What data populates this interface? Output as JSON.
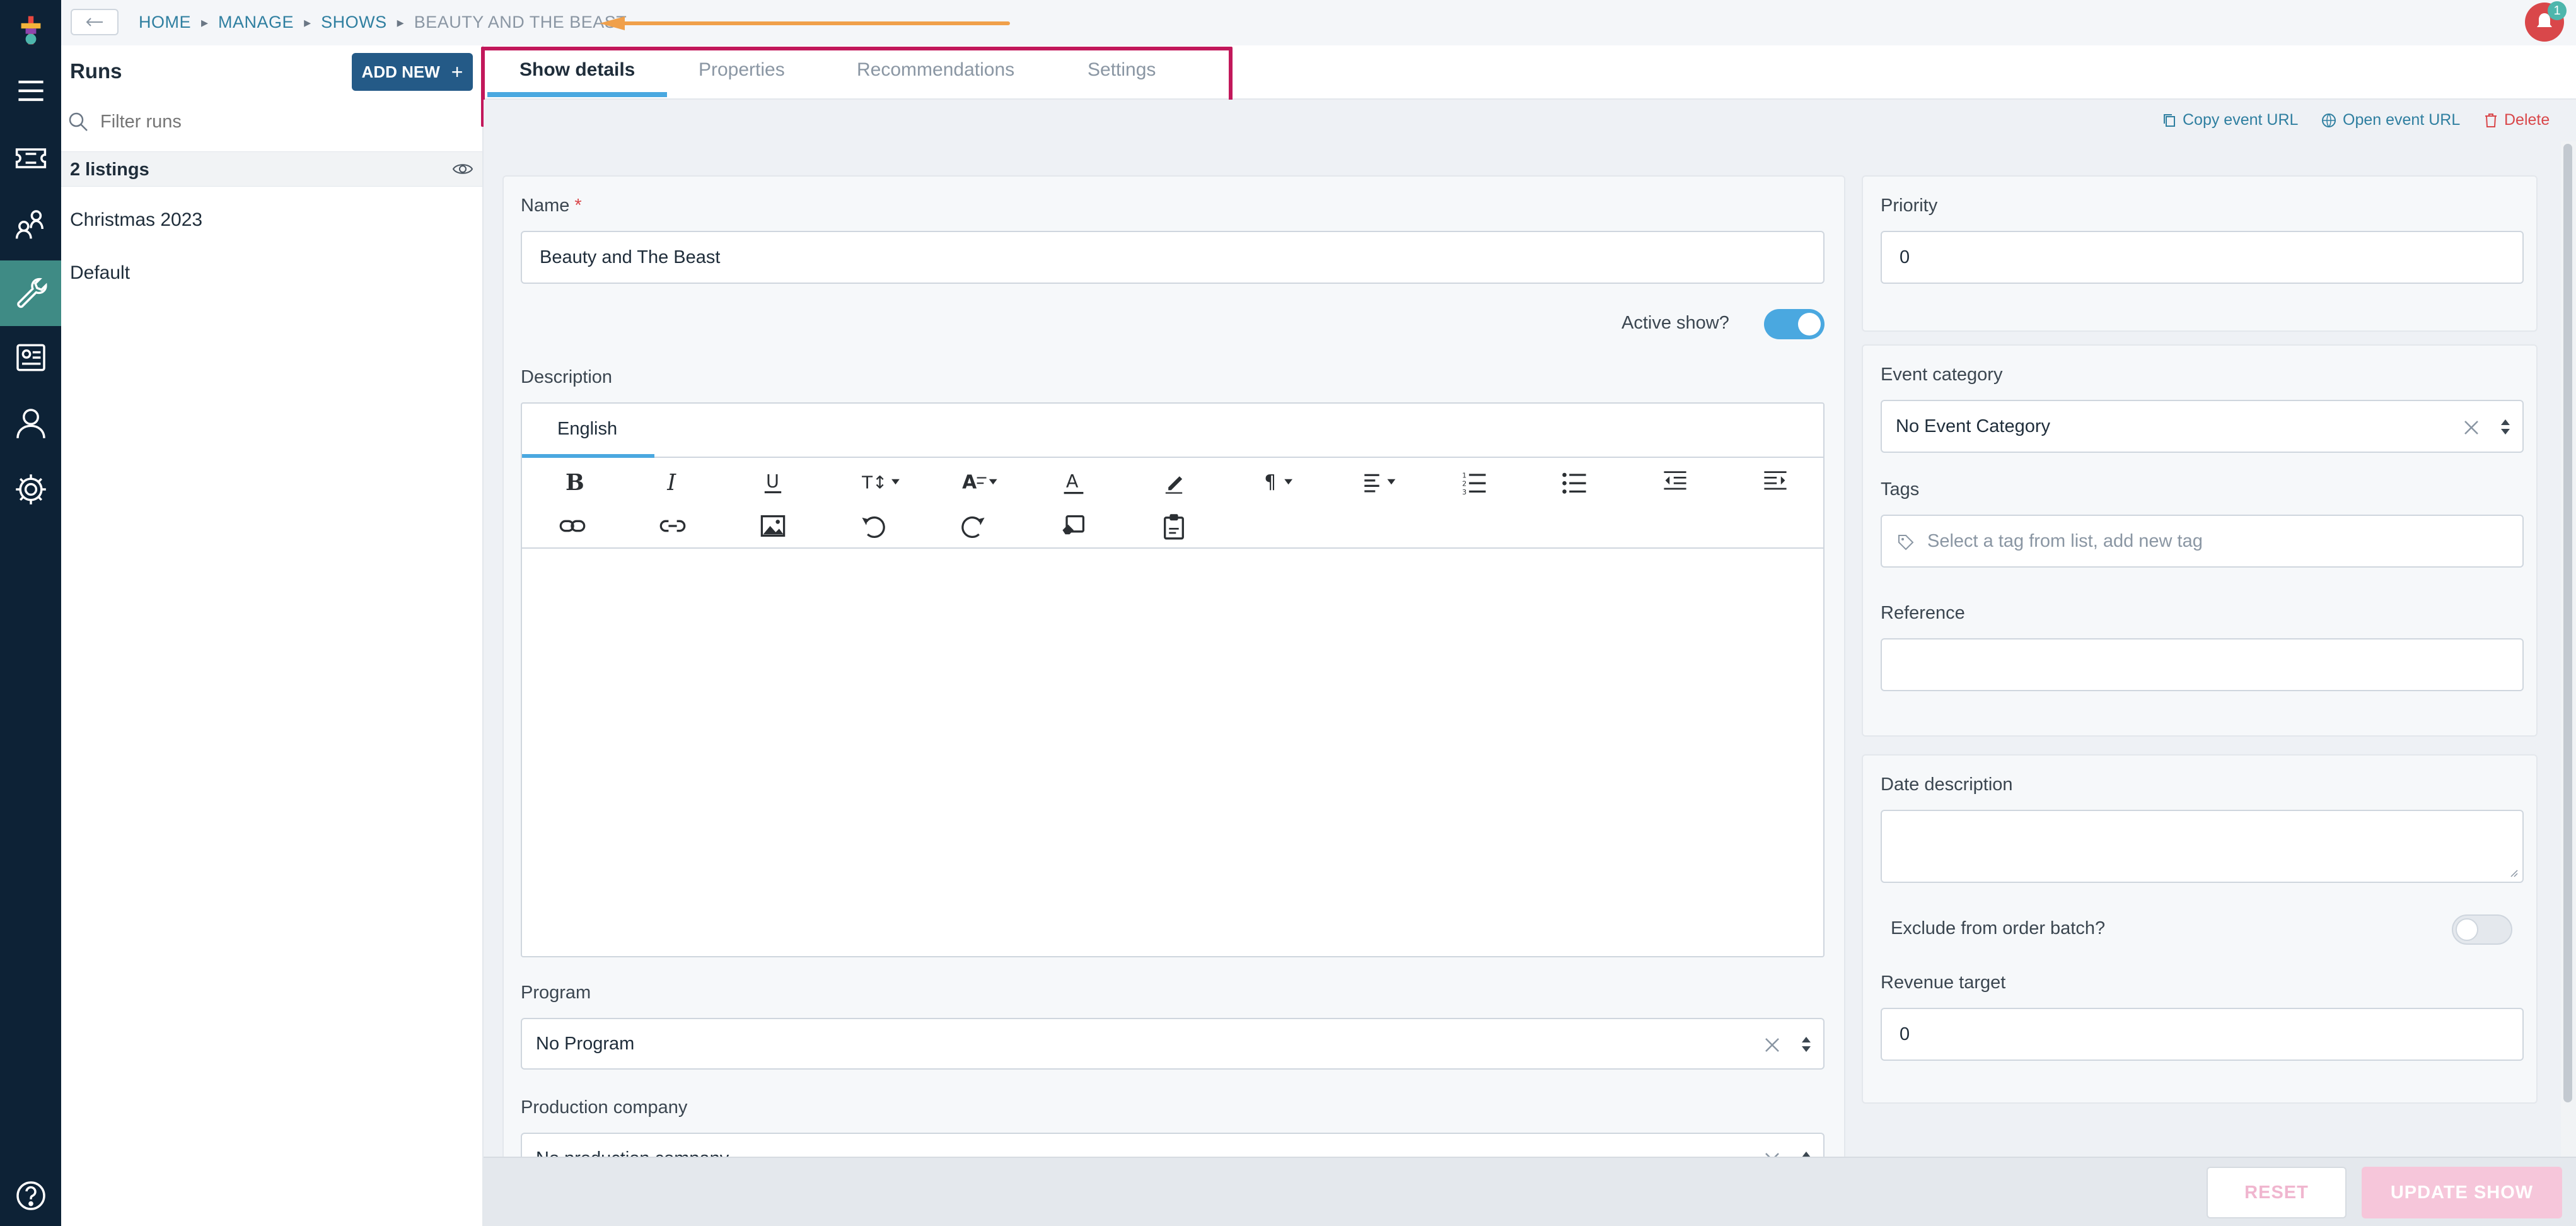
{
  "breadcrumb": {
    "items": [
      "HOME",
      "MANAGE",
      "SHOWS",
      "BEAUTY AND THE BEAST"
    ],
    "back_icon": "arrow-left-icon"
  },
  "notifications": {
    "count": "1"
  },
  "rail": {
    "items": [
      "menu-icon",
      "ticket-icon",
      "people-icon",
      "wrench-icon",
      "report-icon",
      "user-icon",
      "gear-icon",
      "help-icon"
    ],
    "active": "wrench-icon"
  },
  "runs": {
    "title": "Runs",
    "add_label": "ADD NEW",
    "filter_placeholder": "Filter runs",
    "listing_count": "2 listings",
    "items": [
      "Christmas 2023",
      "Default"
    ]
  },
  "tabs": [
    "Show details",
    "Properties",
    "Recommendations",
    "Settings"
  ],
  "active_tab": "Show details",
  "actions": {
    "copy": "Copy event URL",
    "open": "Open event URL",
    "delete": "Delete"
  },
  "form": {
    "name_label": "Name",
    "required_mark": "*",
    "name_value": "Beauty and The Beast",
    "active_label": "Active show?",
    "active_on": true,
    "description_label": "Description",
    "language_tab": "English",
    "program_label": "Program",
    "program_value": "No Program",
    "production_label": "Production company",
    "production_value": "No production company"
  },
  "side": {
    "priority_label": "Priority",
    "priority_value": "0",
    "category_label": "Event category",
    "category_value": "No Event Category",
    "tags_label": "Tags",
    "tags_placeholder": "Select a tag from list, add new tag",
    "reference_label": "Reference",
    "reference_value": "",
    "date_desc_label": "Date description",
    "exclude_label": "Exclude from order batch?",
    "exclude_on": false,
    "revenue_label": "Revenue target",
    "revenue_value": "0"
  },
  "footer": {
    "reset": "RESET",
    "update": "UPDATE SHOW"
  },
  "colors": {
    "rail": "#0d2236",
    "rail_active": "#3f8b85",
    "accent": "#2f7fa0",
    "primary_button": "#245a87",
    "highlight_box": "#c2185b",
    "arrow": "#f0a04b",
    "toggle_on": "#4aa8e0",
    "danger": "#d9474a"
  }
}
